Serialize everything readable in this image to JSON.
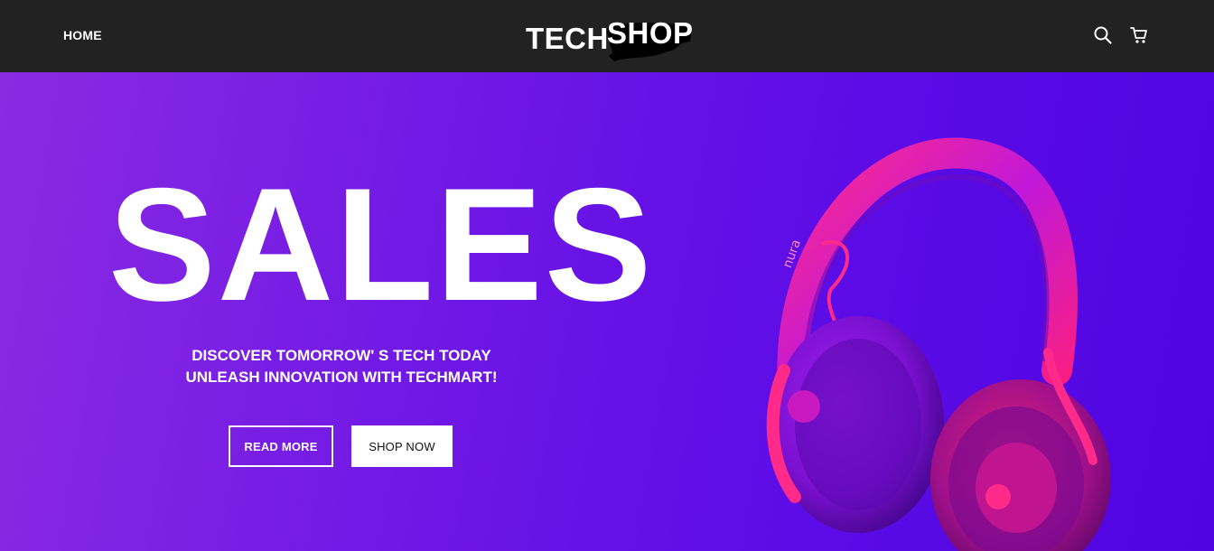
{
  "nav": {
    "home_label": "HOME",
    "logo_left": "TECH",
    "logo_right": "SHOP",
    "icons": [
      "search-icon",
      "cart-icon"
    ]
  },
  "hero": {
    "title": "SALES",
    "subtitle_line1": "DISCOVER TOMORROW' S TECH TODAY",
    "subtitle_line2": "UNLEASH INNOVATION WITH TECHMART!",
    "read_more_label": "READ MORE",
    "shop_now_label": "SHOP NOW",
    "product_brand": "nura"
  },
  "colors": {
    "navbar": "#222222",
    "hero_gradient_start": "#8a2be2",
    "hero_gradient_end": "#4f05e0",
    "headphone_accent": "#ff1f8e"
  }
}
